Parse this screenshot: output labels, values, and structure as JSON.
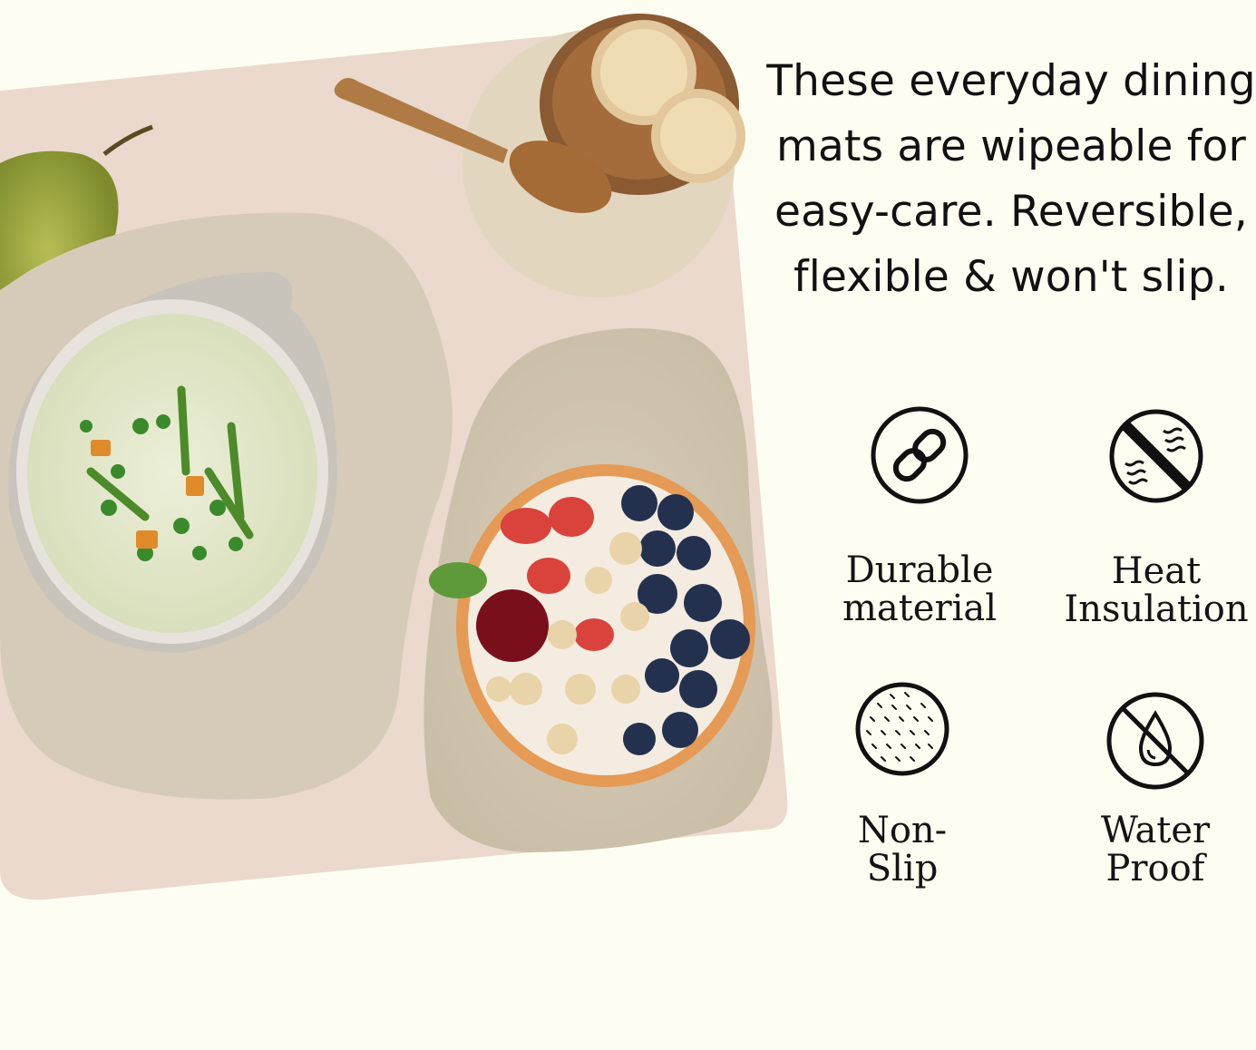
{
  "headline": {
    "lines": [
      "These everyday dining",
      "mats are wipeable for",
      "easy-care. Reversible,",
      "flexible & won't slip."
    ]
  },
  "features": {
    "durable": {
      "icon": "chain-link-icon",
      "label_lines": [
        "Durable",
        "material"
      ]
    },
    "heat": {
      "icon": "heat-waves-crossed-icon",
      "label_lines": [
        "Heat",
        "Insulation"
      ]
    },
    "nonslip": {
      "icon": "textured-circle-icon",
      "label_lines": [
        "Non-",
        "Slip"
      ]
    },
    "water": {
      "icon": "water-drop-crossed-icon",
      "label_lines": [
        "Water",
        "Proof"
      ]
    }
  },
  "colors": {
    "background": "#fefdf1",
    "tablecloth": "#ead9cc",
    "mat": "#d6cbb8",
    "icon_ink": "#111111"
  }
}
